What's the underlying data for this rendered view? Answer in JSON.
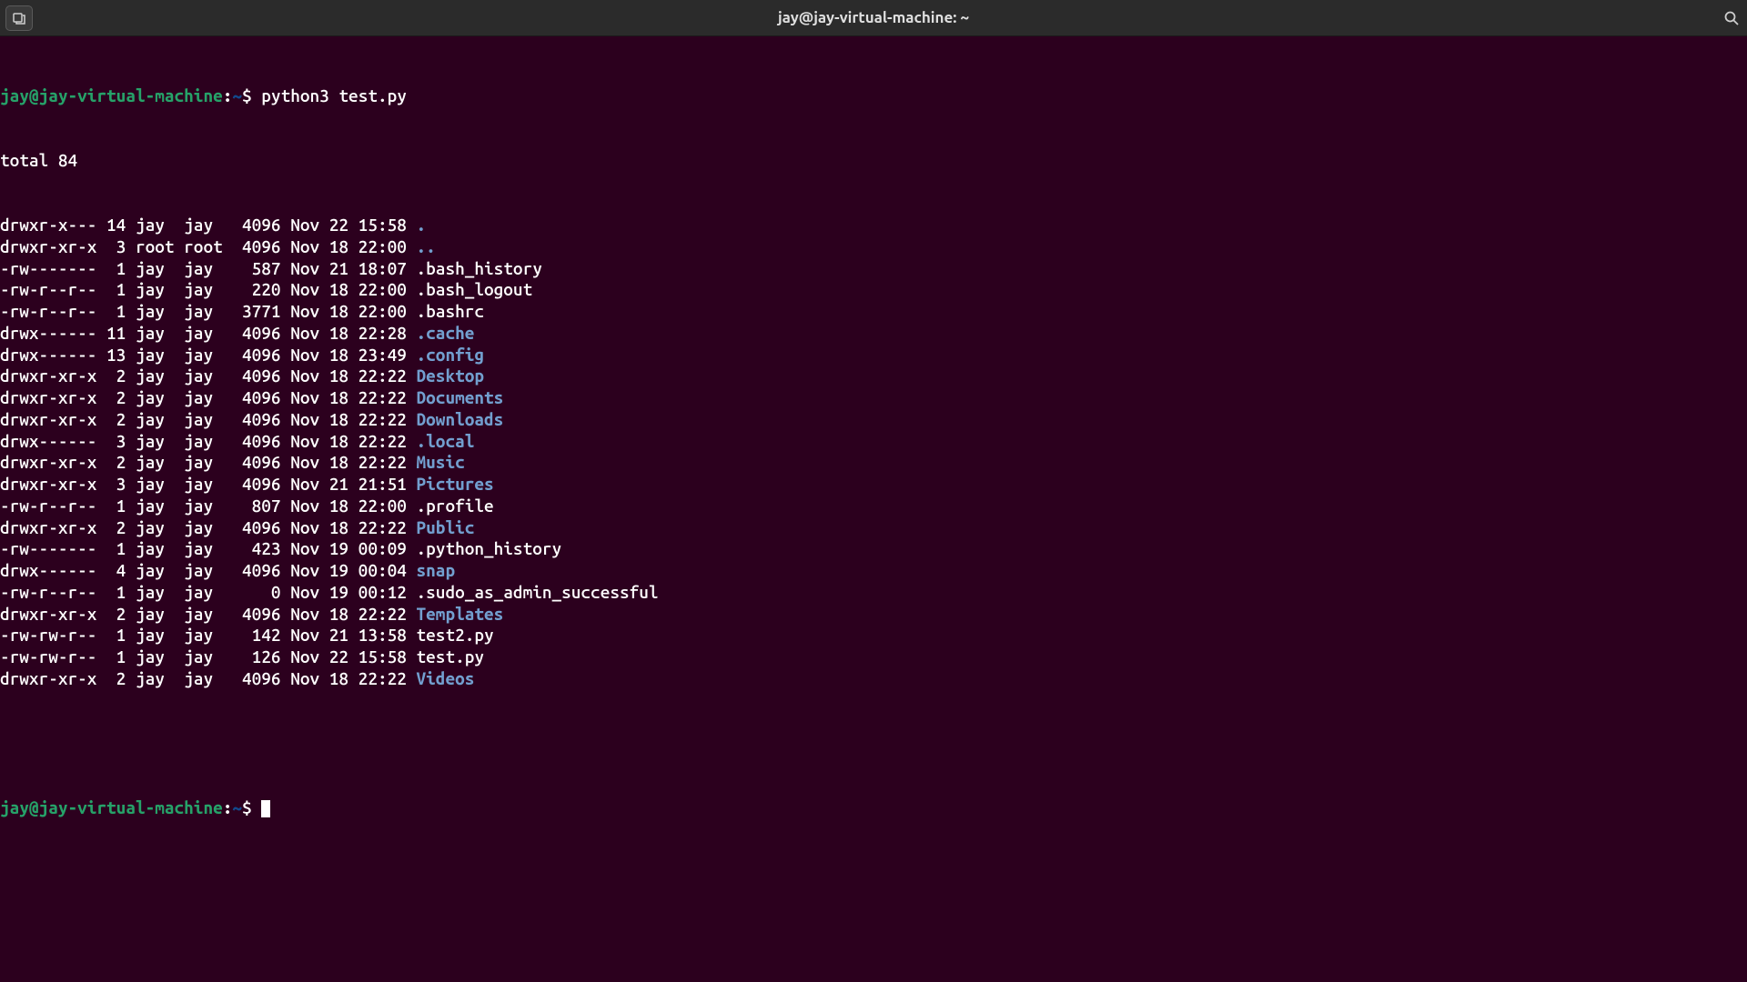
{
  "titlebar": {
    "title": "jay@jay-virtual-machine: ~"
  },
  "prompt": {
    "user_host": "jay@jay-virtual-machine",
    "colon": ":",
    "path": "~",
    "dollar": "$"
  },
  "command1": "python3 test.py",
  "total_line": "total 84",
  "listing": [
    {
      "perms": "drwxr-x---",
      "links": "14",
      "owner": "jay ",
      "group": "jay ",
      "size": " 4096",
      "date": "Nov 22 15:58",
      "name": ".",
      "is_dir": true
    },
    {
      "perms": "drwxr-xr-x",
      "links": " 3",
      "owner": "root",
      "group": "root",
      "size": " 4096",
      "date": "Nov 18 22:00",
      "name": "..",
      "is_dir": true
    },
    {
      "perms": "-rw-------",
      "links": " 1",
      "owner": "jay ",
      "group": "jay ",
      "size": "  587",
      "date": "Nov 21 18:07",
      "name": ".bash_history",
      "is_dir": false
    },
    {
      "perms": "-rw-r--r--",
      "links": " 1",
      "owner": "jay ",
      "group": "jay ",
      "size": "  220",
      "date": "Nov 18 22:00",
      "name": ".bash_logout",
      "is_dir": false
    },
    {
      "perms": "-rw-r--r--",
      "links": " 1",
      "owner": "jay ",
      "group": "jay ",
      "size": " 3771",
      "date": "Nov 18 22:00",
      "name": ".bashrc",
      "is_dir": false
    },
    {
      "perms": "drwx------",
      "links": "11",
      "owner": "jay ",
      "group": "jay ",
      "size": " 4096",
      "date": "Nov 18 22:28",
      "name": ".cache",
      "is_dir": true
    },
    {
      "perms": "drwx------",
      "links": "13",
      "owner": "jay ",
      "group": "jay ",
      "size": " 4096",
      "date": "Nov 18 23:49",
      "name": ".config",
      "is_dir": true
    },
    {
      "perms": "drwxr-xr-x",
      "links": " 2",
      "owner": "jay ",
      "group": "jay ",
      "size": " 4096",
      "date": "Nov 18 22:22",
      "name": "Desktop",
      "is_dir": true
    },
    {
      "perms": "drwxr-xr-x",
      "links": " 2",
      "owner": "jay ",
      "group": "jay ",
      "size": " 4096",
      "date": "Nov 18 22:22",
      "name": "Documents",
      "is_dir": true
    },
    {
      "perms": "drwxr-xr-x",
      "links": " 2",
      "owner": "jay ",
      "group": "jay ",
      "size": " 4096",
      "date": "Nov 18 22:22",
      "name": "Downloads",
      "is_dir": true
    },
    {
      "perms": "drwx------",
      "links": " 3",
      "owner": "jay ",
      "group": "jay ",
      "size": " 4096",
      "date": "Nov 18 22:22",
      "name": ".local",
      "is_dir": true
    },
    {
      "perms": "drwxr-xr-x",
      "links": " 2",
      "owner": "jay ",
      "group": "jay ",
      "size": " 4096",
      "date": "Nov 18 22:22",
      "name": "Music",
      "is_dir": true
    },
    {
      "perms": "drwxr-xr-x",
      "links": " 3",
      "owner": "jay ",
      "group": "jay ",
      "size": " 4096",
      "date": "Nov 21 21:51",
      "name": "Pictures",
      "is_dir": true
    },
    {
      "perms": "-rw-r--r--",
      "links": " 1",
      "owner": "jay ",
      "group": "jay ",
      "size": "  807",
      "date": "Nov 18 22:00",
      "name": ".profile",
      "is_dir": false
    },
    {
      "perms": "drwxr-xr-x",
      "links": " 2",
      "owner": "jay ",
      "group": "jay ",
      "size": " 4096",
      "date": "Nov 18 22:22",
      "name": "Public",
      "is_dir": true
    },
    {
      "perms": "-rw-------",
      "links": " 1",
      "owner": "jay ",
      "group": "jay ",
      "size": "  423",
      "date": "Nov 19 00:09",
      "name": ".python_history",
      "is_dir": false
    },
    {
      "perms": "drwx------",
      "links": " 4",
      "owner": "jay ",
      "group": "jay ",
      "size": " 4096",
      "date": "Nov 19 00:04",
      "name": "snap",
      "is_dir": true
    },
    {
      "perms": "-rw-r--r--",
      "links": " 1",
      "owner": "jay ",
      "group": "jay ",
      "size": "    0",
      "date": "Nov 19 00:12",
      "name": ".sudo_as_admin_successful",
      "is_dir": false
    },
    {
      "perms": "drwxr-xr-x",
      "links": " 2",
      "owner": "jay ",
      "group": "jay ",
      "size": " 4096",
      "date": "Nov 18 22:22",
      "name": "Templates",
      "is_dir": true
    },
    {
      "perms": "-rw-rw-r--",
      "links": " 1",
      "owner": "jay ",
      "group": "jay ",
      "size": "  142",
      "date": "Nov 21 13:58",
      "name": "test2.py",
      "is_dir": false
    },
    {
      "perms": "-rw-rw-r--",
      "links": " 1",
      "owner": "jay ",
      "group": "jay ",
      "size": "  126",
      "date": "Nov 22 15:58",
      "name": "test.py",
      "is_dir": false
    },
    {
      "perms": "drwxr-xr-x",
      "links": " 2",
      "owner": "jay ",
      "group": "jay ",
      "size": " 4096",
      "date": "Nov 18 22:22",
      "name": "Videos",
      "is_dir": true
    }
  ]
}
